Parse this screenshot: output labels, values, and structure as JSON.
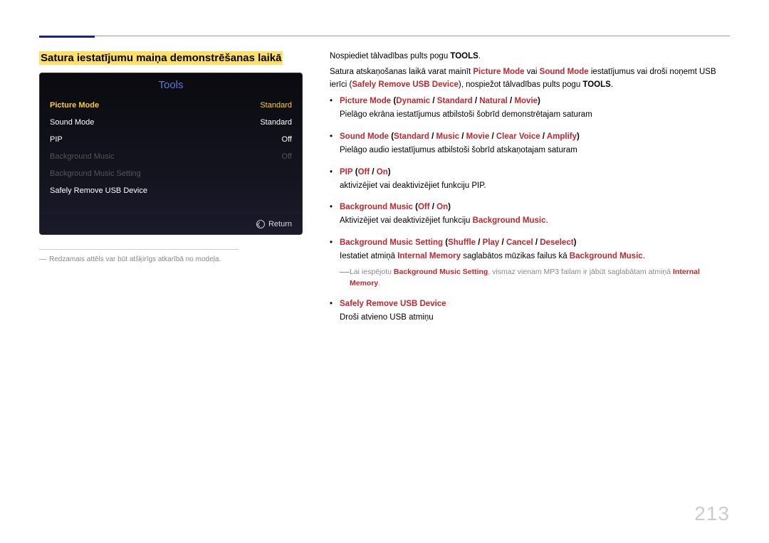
{
  "heading": "Satura iestatījumu maiņa demonstrēšanas laikā",
  "tools": {
    "title": "Tools",
    "rows": {
      "r0": {
        "label": "Picture Mode",
        "value": "Standard"
      },
      "r1": {
        "label": "Sound Mode",
        "value": "Standard"
      },
      "r2": {
        "label": "PIP",
        "value": "Off"
      },
      "r3": {
        "label": "Background Music",
        "value": "Off"
      },
      "r4": {
        "label": "Background Music Setting",
        "value": ""
      },
      "r5": {
        "label": "Safely Remove USB Device",
        "value": ""
      }
    },
    "return": "Return"
  },
  "imgnote": "Redzamais attēls var būt atšķirīgs atkarībā no modeļa.",
  "intro": {
    "p1a": "Nospiediet tālvadības pults pogu ",
    "p1b": "TOOLS",
    "p1c": ".",
    "p2a": "Satura atskaņošanas laikā varat mainīt ",
    "p2b": "Picture Mode",
    "p2c": " vai ",
    "p2d": "Sound Mode",
    "p2e": " iestatījumus vai droši noņemt USB ierīci (",
    "p2f": "Safely Remove USB Device",
    "p2g": "), nospiežot tālvadības pults pogu ",
    "p2h": "TOOLS",
    "p2i": "."
  },
  "items": {
    "pm": {
      "t": "Picture Mode",
      "o1": "Dynamic",
      "o2": "Standard",
      "o3": "Natural",
      "o4": "Movie",
      "sub": "Pielāgo ekrāna iestatījumus atbilstoši šobrīd demonstrētajam saturam"
    },
    "sm": {
      "t": "Sound Mode",
      "o1": "Standard",
      "o2": "Music",
      "o3": "Movie",
      "o4": "Clear Voice",
      "o5": "Amplify",
      "sub": "Pielāgo audio iestatījumus atbilstoši šobrīd atskaņotajam saturam"
    },
    "pip": {
      "t": "PIP",
      "o1": "Off",
      "o2": "On",
      "sub": "aktivizējiet vai deaktivizējiet funkciju PIP."
    },
    "bgm": {
      "t": "Background Music",
      "o1": "Off",
      "o2": "On",
      "suba": "Aktivizējiet vai deaktivizējiet funkciju ",
      "subb": "Background Music",
      "subc": "."
    },
    "bgms": {
      "t": "Background Music Setting",
      "o1": "Shuffle",
      "o2": "Play",
      "o3": "Cancel",
      "o4": "Deselect",
      "suba": "Iestatiet atmiņā ",
      "subb": "Internal Memory",
      "subc": " saglabātos mūzikas failus kā ",
      "subd": "Background Music",
      "sube": "."
    },
    "note": {
      "a": "Lai iespējotu ",
      "b": "Background Music Setting",
      "c": ", vismaz vienam MP3 failam ir jābūt saglabātam atmiņā ",
      "d": "Internal Memory",
      "e": "."
    },
    "sr": {
      "t": "Safely Remove USB Device",
      "sub": "Droši atvieno USB atmiņu"
    }
  },
  "pagenum": "213"
}
